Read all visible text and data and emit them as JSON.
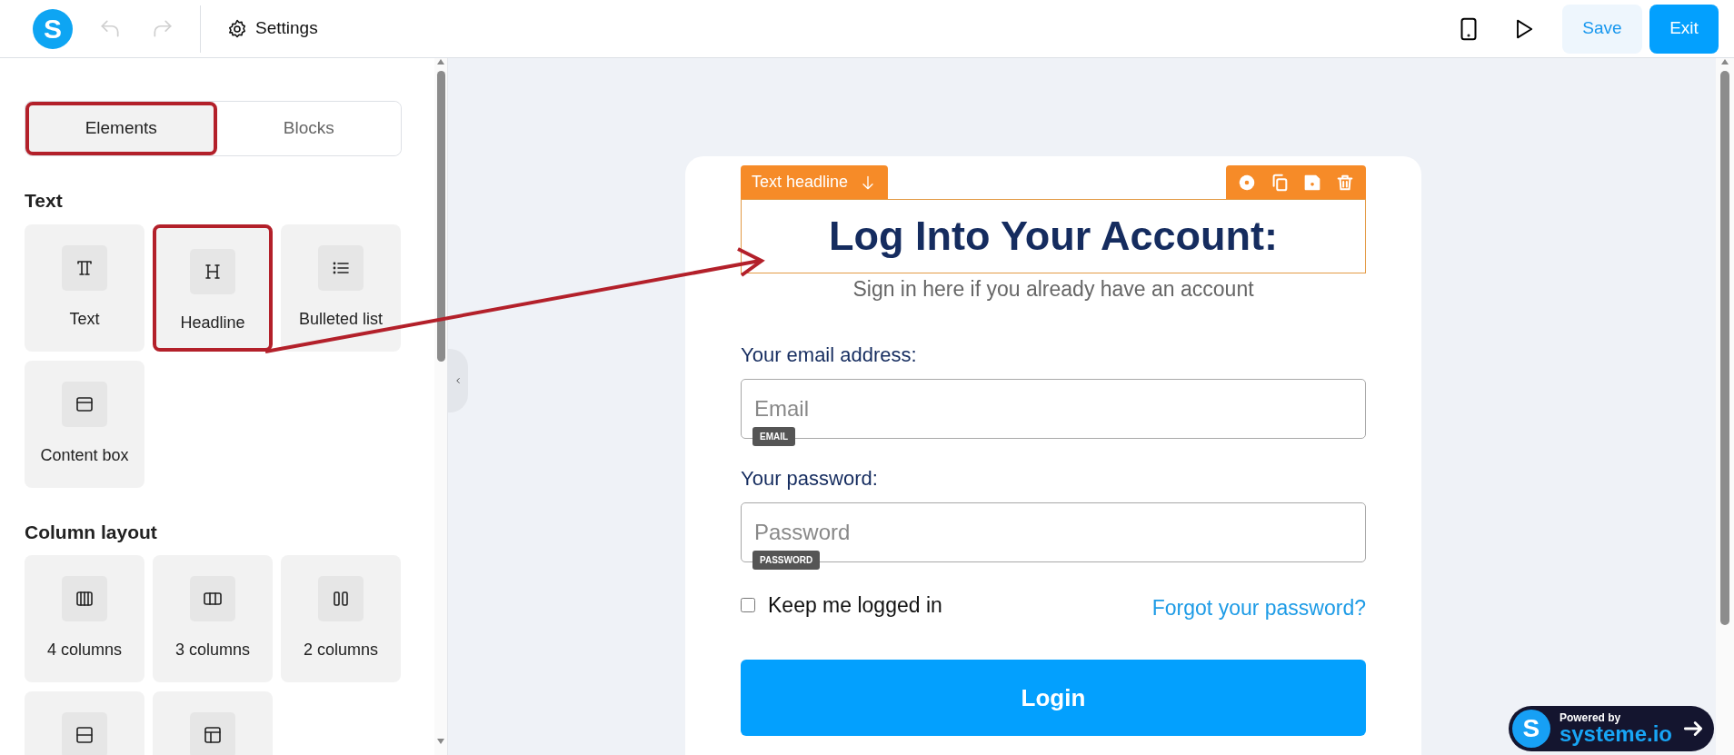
{
  "topbar": {
    "logo": "S",
    "settings": "Settings",
    "undo_disabled": true,
    "redo_disabled": true,
    "save": "Save",
    "exit": "Exit"
  },
  "sidebar": {
    "tabs": [
      {
        "label": "Elements",
        "selected": true,
        "highlighted": true
      },
      {
        "label": "Blocks",
        "selected": false,
        "highlighted": false
      }
    ],
    "sections": [
      {
        "title": "Text",
        "tiles": [
          {
            "label": "Text",
            "kind": "text",
            "highlighted": false
          },
          {
            "label": "Headline",
            "kind": "headline",
            "highlighted": true
          },
          {
            "label": "Bulleted list",
            "kind": "list",
            "highlighted": false
          },
          {
            "label": "Content box",
            "kind": "box",
            "highlighted": false
          }
        ]
      },
      {
        "title": "Column layout",
        "tiles": [
          {
            "label": "4 columns",
            "kind": "col4",
            "highlighted": false
          },
          {
            "label": "3 columns",
            "kind": "col3",
            "highlighted": false
          },
          {
            "label": "2 columns",
            "kind": "col2",
            "highlighted": false
          },
          {
            "kind": "rows",
            "highlighted": false
          },
          {
            "kind": "layout",
            "highlighted": false
          }
        ]
      }
    ]
  },
  "form": {
    "toolbar_label": "Text headline",
    "headline": "Log Into Your Account:",
    "subtitle": "Sign in here if you already have an account",
    "fields": [
      {
        "label": "Your email address:",
        "placeholder": "Email",
        "tag": "EMAIL"
      },
      {
        "label": "Your password:",
        "placeholder": "Password",
        "tag": "PASSWORD"
      }
    ],
    "remember": {
      "label": "Keep me logged in",
      "checked": false
    },
    "forgot": "Forgot your password?",
    "login": "Login"
  },
  "badge": {
    "logo": "S",
    "line1": "Powered by",
    "line2": "systeme.io"
  }
}
